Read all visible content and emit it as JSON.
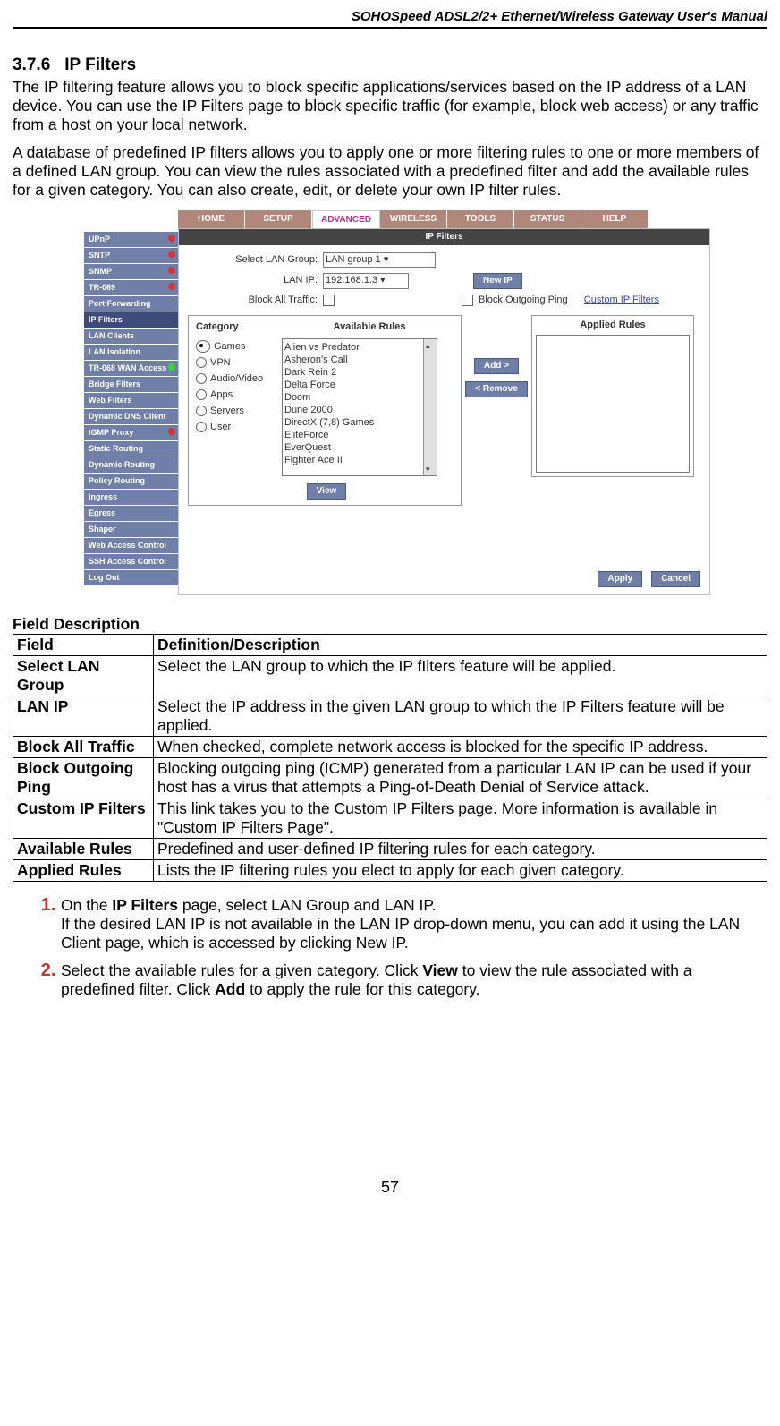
{
  "header": "SOHOSpeed ADSL2/2+ Ethernet/Wireless Gateway User's Manual",
  "section": {
    "num": "3.7.6",
    "title": "IP Filters"
  },
  "intro1": "The IP filtering feature allows you to block specific applications/services based on the IP address of a LAN device. You can use the IP Filters page to block specific traffic (for example, block web access) or any traffic from a host on your local network.",
  "intro2": "A database of predefined IP filters allows you to apply one or more filtering rules to one or more members of a defined LAN group. You can view the rules associated with a predefined filter and add the available rules for a given category. You can also create, edit, or delete your own IP filter rules.",
  "tabs": [
    "HOME",
    "SETUP",
    "ADVANCED",
    "WIRELESS",
    "TOOLS",
    "STATUS",
    "HELP"
  ],
  "active_tab": "ADVANCED",
  "sidebar": [
    {
      "label": "UPnP",
      "dot": "red"
    },
    {
      "label": "SNTP",
      "dot": "red"
    },
    {
      "label": "SNMP",
      "dot": "red"
    },
    {
      "label": "TR-069",
      "dot": "red"
    },
    {
      "label": "Port Forwarding"
    },
    {
      "label": "IP Filters",
      "active": true
    },
    {
      "label": "LAN Clients"
    },
    {
      "label": "LAN Isolation"
    },
    {
      "label": "TR-068 WAN Access",
      "dot": "green"
    },
    {
      "label": "Bridge Filters"
    },
    {
      "label": "Web Filters"
    },
    {
      "label": "Dynamic DNS Client"
    },
    {
      "label": "IGMP Proxy",
      "dot": "red"
    },
    {
      "label": "Static Routing"
    },
    {
      "label": "Dynamic Routing"
    },
    {
      "label": "Policy Routing"
    },
    {
      "label": "Ingress"
    },
    {
      "label": "Egress"
    },
    {
      "label": "Shaper"
    },
    {
      "label": "Web Access Control"
    },
    {
      "label": "SSH Access Control"
    },
    {
      "label": "Log Out"
    }
  ],
  "panel": {
    "title": "IP Filters",
    "select_lan_label": "Select LAN Group:",
    "select_lan_value": "LAN group 1",
    "lan_ip_label": "LAN IP:",
    "lan_ip_value": "192.168.1.3",
    "new_ip": "New IP",
    "block_all_label": "Block All Traffic:",
    "block_outgoing_label": "Block Outgoing Ping",
    "custom_ip_link": "Custom IP Filters",
    "category_header": "Category",
    "available_header": "Available Rules",
    "applied_header": "Applied Rules",
    "categories": [
      "Games",
      "VPN",
      "Audio/Video",
      "Apps",
      "Servers",
      "User"
    ],
    "available_rules": [
      "Alien vs Predator",
      "Asheron's Call",
      "Dark Rein 2",
      "Delta Force",
      "Doom",
      "Dune 2000",
      "DirectX (7,8) Games",
      "EliteForce",
      "EverQuest",
      "Fighter Ace II"
    ],
    "btn_add": "Add >",
    "btn_remove": "< Remove",
    "btn_view": "View",
    "btn_apply": "Apply",
    "btn_cancel": "Cancel"
  },
  "fd_title": "Field Description",
  "fd_head_field": "Field",
  "fd_head_def": "Definition/Description",
  "fd_rows": [
    {
      "field": "Select LAN Group",
      "def": "Select the LAN group to which the IP fIlters feature will be applied."
    },
    {
      "field": "LAN IP",
      "def": "Select the IP address in the given LAN group to which the IP Filters feature will be applied."
    },
    {
      "field": "Block All Traffic",
      "def": "When checked, complete network access is blocked for the specific IP address."
    },
    {
      "field": "Block Outgoing Ping",
      "def": "Blocking outgoing ping (ICMP) generated from a particular LAN IP can be used if your host has a virus that attempts a Ping-of-Death Denial of Service attack."
    },
    {
      "field": "Custom IP Filters",
      "def": "This link takes you to the Custom IP Filters page. More information is available in \"Custom IP Filters Page\"."
    },
    {
      "field": "Available Rules",
      "def": "Predefined and user-defined IP filtering rules for each category."
    },
    {
      "field": "Applied Rules",
      "def": "Lists the IP filtering rules you elect to apply for each given category."
    }
  ],
  "steps": {
    "s1a": "On the ",
    "s1b": "IP Filters",
    "s1c": " page, select LAN Group and LAN IP.",
    "s1d": "If the desired LAN IP is not available in the LAN IP drop-down menu, you can add it using the LAN Client page, which is accessed by clicking New IP.",
    "s2a": "Select the available rules for a given category. Click ",
    "s2b": "View",
    "s2c": " to view the rule associated with a predefined filter. Click ",
    "s2d": "Add",
    "s2e": " to apply the rule for this category."
  },
  "page_num": "57"
}
